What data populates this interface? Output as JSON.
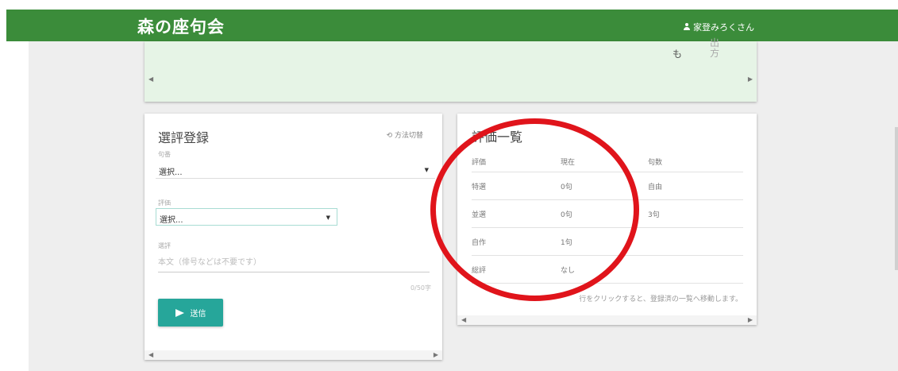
{
  "header": {
    "brand": "森の座句会",
    "user_name": "家登みろくさん"
  },
  "top_card": {
    "vertical_chars": [
      "も",
      "出",
      "方"
    ]
  },
  "selection_form": {
    "title": "選評登録",
    "switch_method_label": "方法切替",
    "haiku_field": {
      "label": "句番",
      "value": "選択..."
    },
    "rating_field": {
      "label": "評価",
      "value": "選択..."
    },
    "comment_field": {
      "label": "選評",
      "placeholder": "本文（俳号などは不要です）",
      "counter": "0/50字"
    },
    "submit_label": "送信"
  },
  "evaluation_list": {
    "title": "評価一覧",
    "columns": [
      "評価",
      "現在",
      "句数"
    ],
    "rows": [
      [
        "特選",
        "0句",
        "自由"
      ],
      [
        "並選",
        "0句",
        "3句"
      ],
      [
        "自作",
        "1句",
        ""
      ],
      [
        "総評",
        "なし",
        ""
      ]
    ],
    "hint": "行をクリックすると、登録済の一覧へ移動します。"
  },
  "colors": {
    "header_bg": "#3b8c3a",
    "top_card_bg": "#e6f4e6",
    "button_bg": "#26a69a",
    "annotation": "#e0141b"
  }
}
